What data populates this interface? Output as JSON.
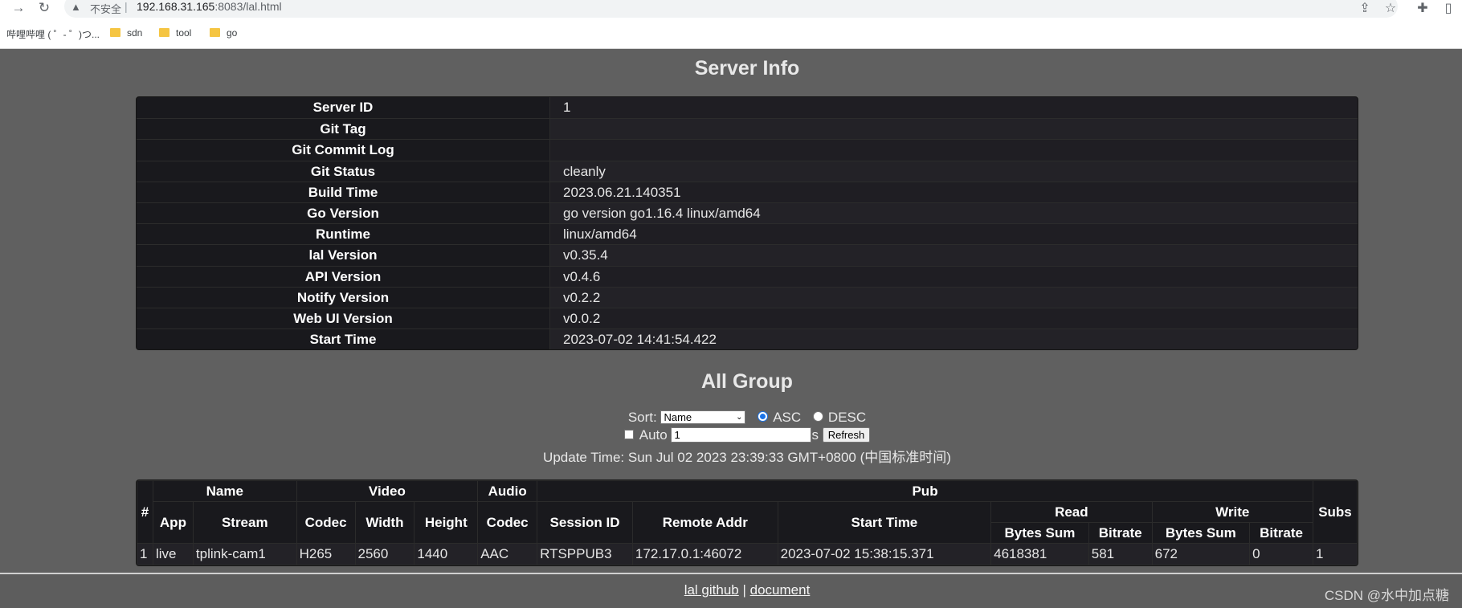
{
  "browser": {
    "security_label": "不安全",
    "url_host": "192.168.31.165",
    "url_rest": ":8083/lal.html",
    "bookmarks": [
      {
        "label": "哔哩哔哩 ( ゜- ゜)つ..."
      },
      {
        "label": "sdn"
      },
      {
        "label": "tool"
      },
      {
        "label": "go"
      }
    ]
  },
  "server_info": {
    "title": "Server Info",
    "rows": [
      {
        "key": "Server ID",
        "value": "1"
      },
      {
        "key": "Git Tag",
        "value": ""
      },
      {
        "key": "Git Commit Log",
        "value": ""
      },
      {
        "key": "Git Status",
        "value": "cleanly"
      },
      {
        "key": "Build Time",
        "value": "2023.06.21.140351"
      },
      {
        "key": "Go Version",
        "value": "go version go1.16.4 linux/amd64"
      },
      {
        "key": "Runtime",
        "value": "linux/amd64"
      },
      {
        "key": "lal Version",
        "value": "v0.35.4"
      },
      {
        "key": "API Version",
        "value": "v0.4.6"
      },
      {
        "key": "Notify Version",
        "value": "v0.2.2"
      },
      {
        "key": "Web UI Version",
        "value": "v0.0.2"
      },
      {
        "key": "Start Time",
        "value": "2023-07-02 14:41:54.422"
      }
    ]
  },
  "all_group": {
    "title": "All Group",
    "sort_label": "Sort:",
    "sort_value": "Name",
    "asc_label": "ASC",
    "desc_label": "DESC",
    "auto_label": "Auto",
    "interval_value": "1",
    "interval_unit": "s",
    "refresh_label": "Refresh",
    "update_time": "Update Time: Sun Jul 02 2023 23:39:33 GMT+0800 (中国标准时间)",
    "headers": {
      "num": "#",
      "name": "Name",
      "video": "Video",
      "audio": "Audio",
      "pub": "Pub",
      "subs": "Subs",
      "app": "App",
      "stream": "Stream",
      "video_codec": "Codec",
      "width": "Width",
      "height": "Height",
      "audio_codec": "Codec",
      "session_id": "Session ID",
      "remote_addr": "Remote Addr",
      "start_time": "Start Time",
      "read": "Read",
      "write": "Write",
      "read_bytes_sum": "Bytes Sum",
      "read_bitrate": "Bitrate",
      "write_bytes_sum": "Bytes Sum",
      "write_bitrate": "Bitrate"
    },
    "rows": [
      {
        "num": "1",
        "app": "live",
        "stream": "tplink-cam1",
        "video_codec": "H265",
        "width": "2560",
        "height": "1440",
        "audio_codec": "AAC",
        "session_id": "RTSPPUB3",
        "remote_addr": "172.17.0.1:46072",
        "start_time": "2023-07-02 15:38:15.371",
        "read_bytes_sum": "4618381",
        "read_bitrate": "581",
        "write_bytes_sum": "672",
        "write_bitrate": "0",
        "subs": "1"
      }
    ]
  },
  "footer": {
    "github_link": "lal github",
    "separator": "|",
    "document_link": "document",
    "watermark": "CSDN @水中加点糖"
  }
}
